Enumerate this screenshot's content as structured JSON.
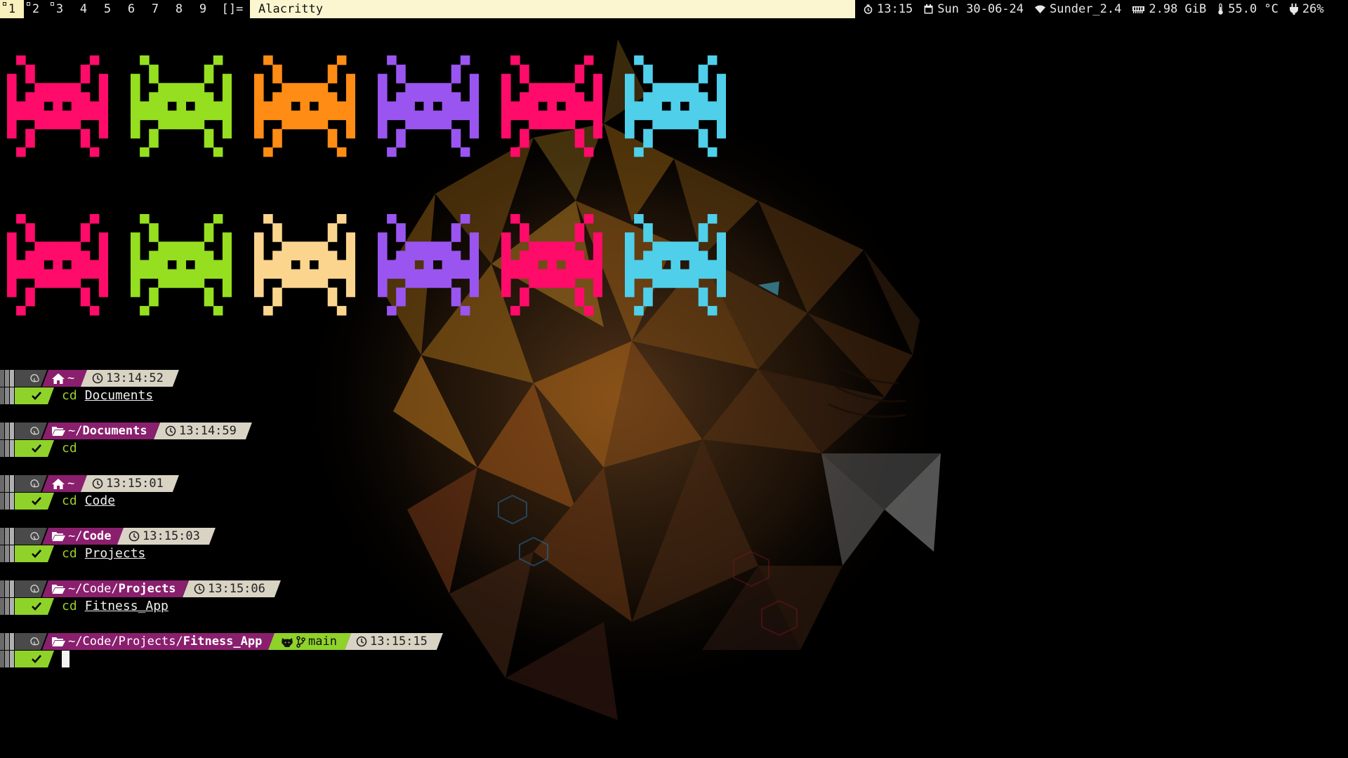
{
  "topbar": {
    "workspaces": [
      {
        "label": "1",
        "active": true,
        "occupied": true
      },
      {
        "label": "2",
        "active": false,
        "occupied": true
      },
      {
        "label": "3",
        "active": false,
        "occupied": true
      },
      {
        "label": "4",
        "active": false,
        "occupied": false
      },
      {
        "label": "5",
        "active": false,
        "occupied": false
      },
      {
        "label": "6",
        "active": false,
        "occupied": false
      },
      {
        "label": "7",
        "active": false,
        "occupied": false
      },
      {
        "label": "8",
        "active": false,
        "occupied": false
      },
      {
        "label": "9",
        "active": false,
        "occupied": false
      }
    ],
    "layout_symbol": "[]=",
    "window_title": "Alacritty",
    "status": {
      "time": "13:15",
      "date": "Sun 30-06-24",
      "wifi": "Sunder_2.4",
      "memory": "2.98 GiB",
      "temperature": "55.0 °C",
      "battery": "26%"
    }
  },
  "invader_colors": [
    [
      "#ff0b6a",
      "#95df20",
      "#ff8c14",
      "#9a55f0",
      "#ff0b6a",
      "#4fcfea"
    ],
    [
      "#ff0b6a",
      "#95df20",
      "#fbd58e",
      "#9a55f0",
      "#ff0b6a",
      "#4fcfea"
    ]
  ],
  "prompts": [
    {
      "dir_plain": "~",
      "dir_bold": "",
      "home": true,
      "time": "13:14:52",
      "cmd": "cd",
      "arg": "Documents",
      "git": ""
    },
    {
      "dir_plain": "~/",
      "dir_bold": "Documents",
      "home": false,
      "time": "13:14:59",
      "cmd": "cd",
      "arg": "",
      "git": ""
    },
    {
      "dir_plain": "~",
      "dir_bold": "",
      "home": true,
      "time": "13:15:01",
      "cmd": "cd",
      "arg": "Code",
      "git": ""
    },
    {
      "dir_plain": "~/",
      "dir_bold": "Code",
      "home": false,
      "time": "13:15:03",
      "cmd": "cd",
      "arg": "Projects",
      "git": ""
    },
    {
      "dir_plain": "~/Code/",
      "dir_bold": "Projects",
      "home": false,
      "time": "13:15:06",
      "cmd": "cd",
      "arg": "Fitness_App",
      "git": ""
    },
    {
      "dir_plain": "~/Code/Projects/",
      "dir_bold": "Fitness_App",
      "home": false,
      "time": "13:15:15",
      "cmd": "",
      "arg": "",
      "git": "main"
    }
  ],
  "colors": {
    "dir_segment": "#8a1f6e",
    "git_segment": "#8fd22a",
    "time_segment": "#d9d3c4",
    "os_segment": "#4a4a4a",
    "status_ok": "#8fd22a",
    "command": "#9bd02b",
    "title_bar": "#fbf6cf"
  },
  "icons": {
    "os": "debian-swirl-icon",
    "home": "home-icon",
    "folder": "folder-open-icon",
    "time": "clock-icon",
    "ok": "checkmark-icon",
    "git": "github-icon",
    "branch": "git-branch-icon"
  }
}
